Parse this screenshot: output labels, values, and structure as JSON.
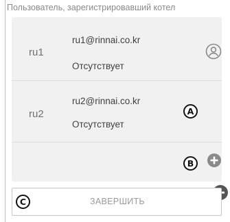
{
  "header": {
    "title": "Пользователь, зарегистрировавший котел"
  },
  "users": [
    {
      "id": "ru1",
      "email": "ru1@rinnai.co.kr",
      "status": "Отсутствует",
      "icon": "user-circle-icon"
    },
    {
      "id": "ru2",
      "email": "ru2@rinnai.co.kr",
      "status": "Отсутствует",
      "icon": "minus-circle-icon"
    }
  ],
  "add_row": {
    "icon": "plus-circle-icon"
  },
  "callouts": {
    "a": "A",
    "b": "B",
    "c": "C"
  },
  "finish_button": {
    "label": "ЗАВЕРШИТЬ"
  },
  "colors": {
    "list_bg": "#f1f1f1",
    "icon_dark": "#555555",
    "icon_light": "#8a8a8a",
    "text_muted": "#9a9a9a"
  }
}
